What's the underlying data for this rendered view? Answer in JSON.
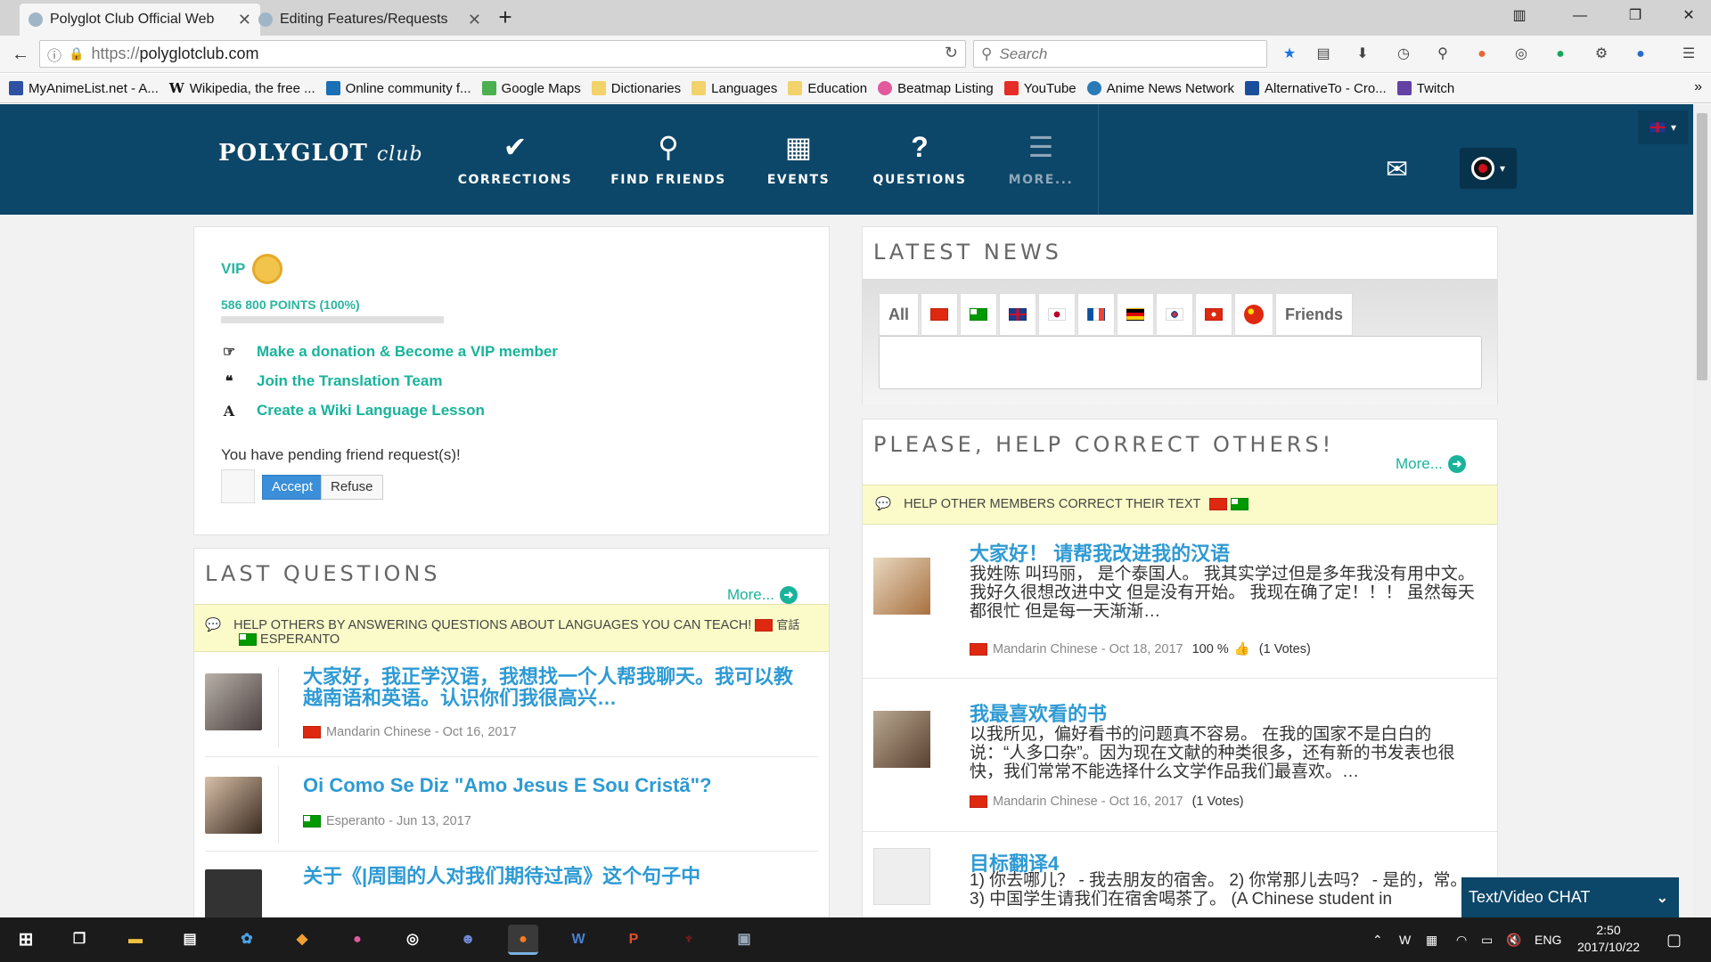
{
  "browser": {
    "tabs": [
      {
        "title": "Polyglot Club Official Web",
        "active": true
      },
      {
        "title": "Editing Features/Requests",
        "active": false
      }
    ],
    "url_scheme": "https://",
    "url_host": "polyglotclub.com",
    "search_placeholder": "Search",
    "bookmarks": [
      {
        "label": "MyAnimeList.net - A...",
        "color": "#2e51a2"
      },
      {
        "label": "Wikipedia, the free ...",
        "color": "#ffffff"
      },
      {
        "label": "Online community f...",
        "color": "#1a6fb5"
      },
      {
        "label": "Google Maps",
        "color": "#4caf50"
      },
      {
        "label": "Dictionaries",
        "color": "#f2d36b"
      },
      {
        "label": "Languages",
        "color": "#f2d36b"
      },
      {
        "label": "Education",
        "color": "#f2d36b"
      },
      {
        "label": "Beatmap Listing",
        "color": "#e05a9c"
      },
      {
        "label": "YouTube",
        "color": "#e52d27"
      },
      {
        "label": "Anime News Network",
        "color": "#2a7ab8"
      },
      {
        "label": "AlternativeTo - Cro...",
        "color": "#1a4f9c"
      },
      {
        "label": "Twitch",
        "color": "#6441a5"
      }
    ]
  },
  "site": {
    "logo_main": "POLYGLOT",
    "logo_sub": "club",
    "nav": [
      {
        "label": "CORRECTIONS",
        "icon": "check-icon"
      },
      {
        "label": "FIND FRIENDS",
        "icon": "search-icon"
      },
      {
        "label": "EVENTS",
        "icon": "calendar-icon"
      },
      {
        "label": "QUESTIONS",
        "icon": "question-icon"
      },
      {
        "label": "MORE...",
        "icon": "menu-icon"
      }
    ]
  },
  "profile": {
    "vip_label": "VIP",
    "points": "586 800 POINTS (100%)",
    "points_fraction": 1.0,
    "links": [
      {
        "label": "Make a donation & Become a VIP member",
        "icon": "thumb-point-icon"
      },
      {
        "label": "Join the Translation Team",
        "icon": "quote-icon"
      },
      {
        "label": "Create a Wiki Language Lesson",
        "icon": "letter-a-icon"
      }
    ],
    "pending_text": "You have pending friend request(s)!",
    "accept_label": "Accept",
    "refuse_label": "Refuse"
  },
  "questions": {
    "title": "LAST QUESTIONS",
    "more_label": "More...",
    "notice_text": "HELP OTHERS BY ANSWERING QUESTIONS ABOUT LANGUAGES YOU CAN TEACH!",
    "notice_lang1": "官話",
    "notice_lang2": "ESPERANTO",
    "items": [
      {
        "title": "大家好，我正学汉语，我想找一个人帮我聊天。我可以教越南语和英语。认识你们我很高兴…",
        "meta": "Mandarin Chinese - Oct 16, 2017",
        "flag": "cn"
      },
      {
        "title": "Oi Como Se Diz \"Amo Jesus E Sou Cristã\"?",
        "meta": "Esperanto - Jun 13, 2017",
        "flag": "eo"
      },
      {
        "title": "关于《|周围的人对我们期待过高》这个句子中",
        "meta": "",
        "flag": "cn"
      }
    ]
  },
  "news": {
    "title": "LATEST NEWS",
    "tab_all": "All",
    "tab_friends": "Friends",
    "flags": [
      "cn",
      "eo",
      "gb",
      "jp",
      "fr",
      "de",
      "kr",
      "hk",
      "cn-round"
    ]
  },
  "corrections": {
    "title": "PLEASE, HELP CORRECT OTHERS!",
    "more_label": "More...",
    "notice_text": "HELP OTHER MEMBERS CORRECT THEIR TEXT",
    "items": [
      {
        "title": "大家好！ 请帮我改进我的汉语",
        "body": "我姓陈 叫玛丽， 是个泰国人。 我其实学过但是多年我没有用中文。我好久很想改进中文 但是没有开始。 我现在确了定！！！ 虽然每天都很忙 但是每一天渐渐…",
        "meta": "Mandarin Chinese - Oct 18, 2017",
        "score": "100 %",
        "votes": "(1 Votes)"
      },
      {
        "title": "我最喜欢看的书",
        "body": "以我所见，偏好看书的问题真不容易。 在我的国家不是白白的说：“人多口杂”。因为现在文献的种类很多，还有新的书发表也很快，我们常常不能选择什么文学作品我们最喜欢。…",
        "meta": "Mandarin Chinese - Oct 16, 2017",
        "score": "",
        "votes": "(1 Votes)"
      },
      {
        "title": "目标翻译4",
        "body": "1) 你去哪儿？ - 我去朋友的宿舍。 2) 你常那儿去吗？ - 是的，常。 3) 中国学生请我们在宿舍喝茶了。 (A Chinese student in",
        "meta": "",
        "score": "",
        "votes": ""
      }
    ]
  },
  "chat": {
    "label": "Text/Video CHAT"
  },
  "taskbar": {
    "lang": "ENG",
    "time": "2:50",
    "date": "2017/10/22"
  }
}
